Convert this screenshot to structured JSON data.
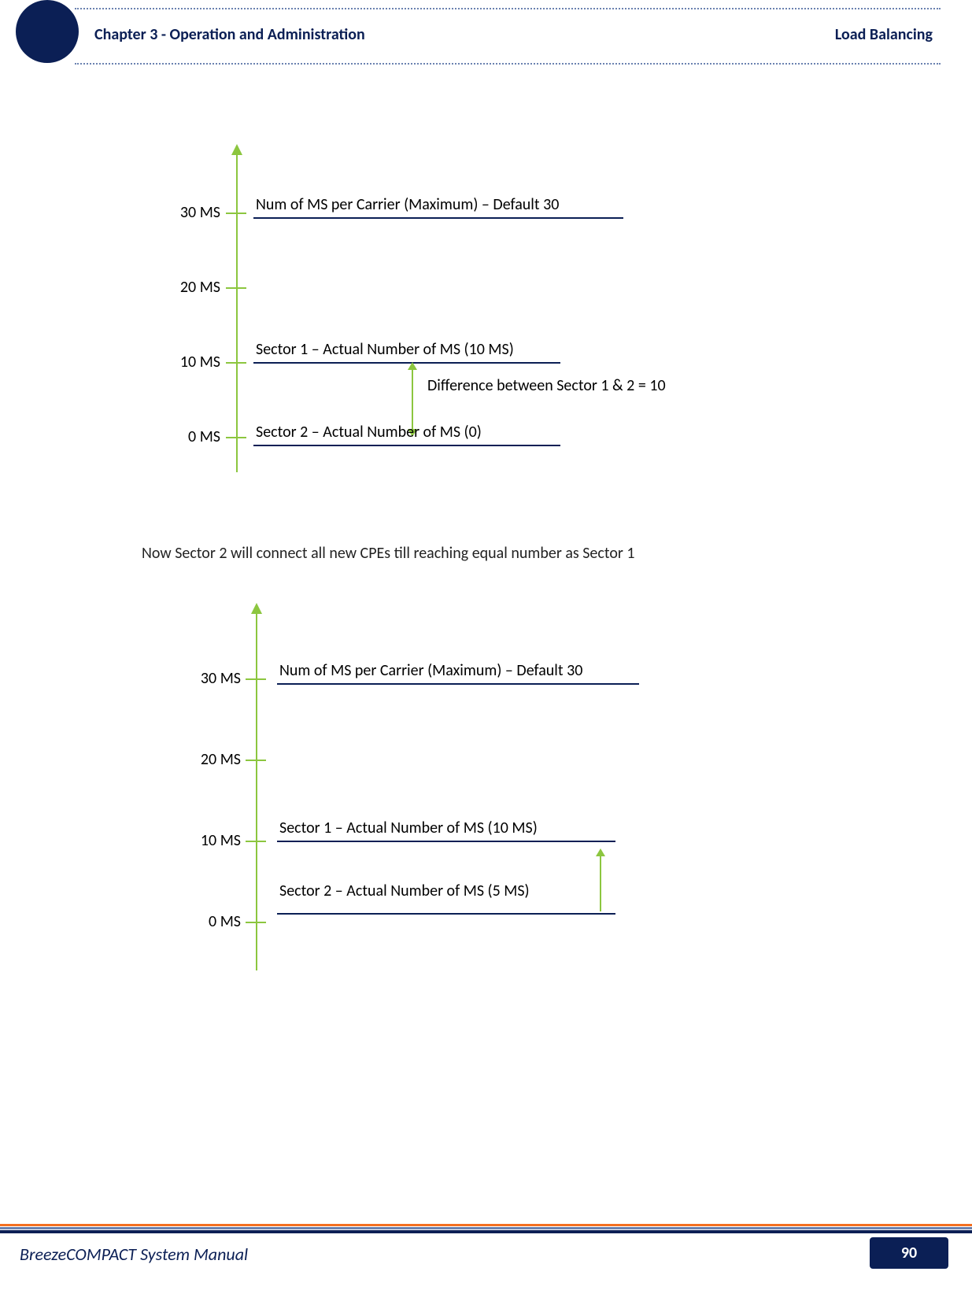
{
  "header": {
    "chapter": "Chapter 3 - Operation and Administration",
    "topic": "Load Balancing"
  },
  "diagram1": {
    "ticks": [
      "30 MS",
      "20 MS",
      "10 MS",
      "0 MS"
    ],
    "max_label": "Num of MS per Carrier (Maximum) – Default 30",
    "sector1": "Sector 1 – Actual Number of MS (10 MS)",
    "diff": "Difference between Sector 1 & 2 = 10",
    "sector2": "Sector 2 – Actual Number of MS (0)"
  },
  "body_text": "Now Sector 2 will connect all new CPEs till reaching equal number as Sector 1",
  "diagram2": {
    "ticks": [
      "30 MS",
      "20 MS",
      "10 MS",
      "0 MS"
    ],
    "max_label": "Num of MS per Carrier (Maximum) – Default 30",
    "sector1": "Sector 1 – Actual Number of MS (10 MS)",
    "sector2": "Sector 2 – Actual Number of MS (5 MS)"
  },
  "footer": {
    "manual": "BreezeCOMPACT System Manual",
    "page": "90"
  },
  "chart_data": [
    {
      "type": "bar",
      "title": "MS Distribution (initial)",
      "ylabel": "MS",
      "ylim": [
        0,
        30
      ],
      "categories": [
        "Maximum per Carrier",
        "Sector 1 Actual",
        "Sector 2 Actual"
      ],
      "values": [
        30,
        10,
        0
      ],
      "annotation": "Difference between Sector 1 & 2 = 10"
    },
    {
      "type": "bar",
      "title": "MS Distribution (after load balancing in progress)",
      "ylabel": "MS",
      "ylim": [
        0,
        30
      ],
      "categories": [
        "Maximum per Carrier",
        "Sector 1 Actual",
        "Sector 2 Actual"
      ],
      "values": [
        30,
        10,
        5
      ]
    }
  ]
}
